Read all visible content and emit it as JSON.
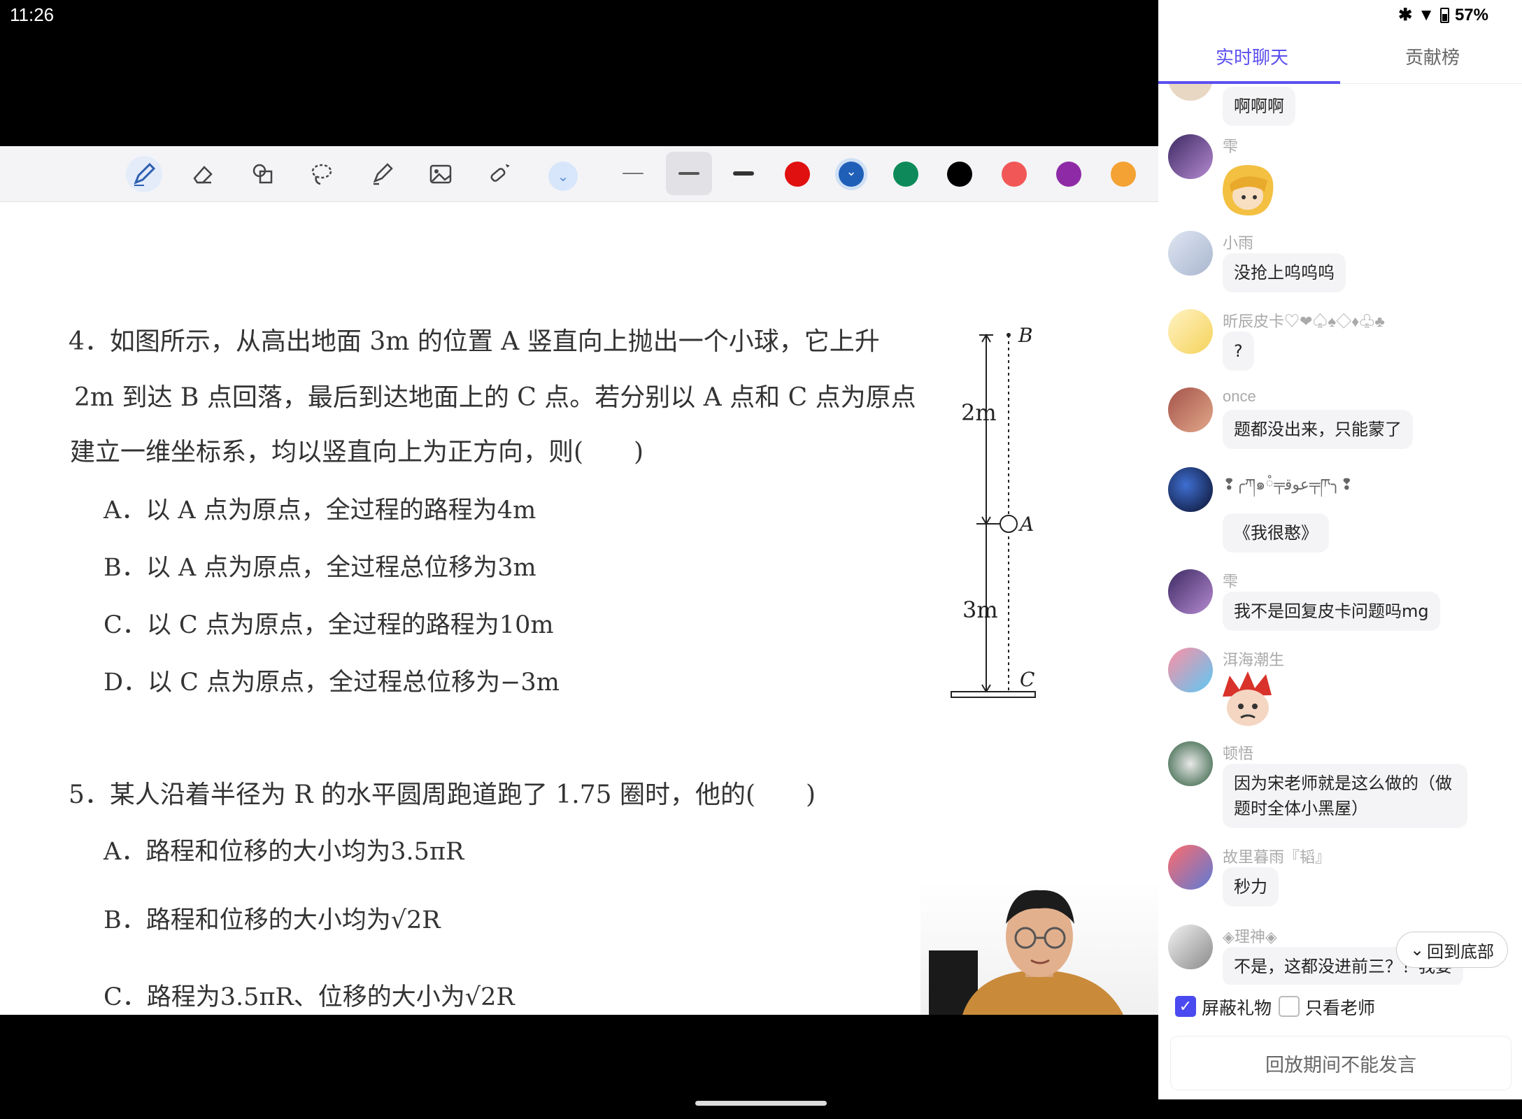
{
  "status": {
    "time": "11:26",
    "battery": "57%"
  },
  "toolbar": {
    "tools": [
      "pen",
      "eraser",
      "shapes",
      "lasso",
      "highlighter",
      "image",
      "laser-pointer"
    ],
    "colors": [
      "#e01010",
      "#1f5fb8",
      "#0e8a5a",
      "#000000",
      "#f25757",
      "#8e2aa6",
      "#f4a233"
    ]
  },
  "question4": {
    "line1": "4．如图所示，从高出地面 3m 的位置 A 竖直向上抛出一个小球，它上升",
    "line2": "2m 到达 B 点回落，最后到达地面上的 C 点。若分别以 A 点和 C 点为原点",
    "line3": "建立一维坐标系，均以竖直向上为正方向，则(　　)",
    "options": [
      "A．以 A 点为原点，全过程的路程为4m",
      "B．以 A 点为原点，全过程总位移为3m",
      "C．以 C 点为原点，全过程的路程为10m",
      "D．以 C 点为原点，全过程总位移为−3m"
    ]
  },
  "diagram": {
    "label_b": "B",
    "label_a": "A",
    "label_c": "C",
    "upper": "2m",
    "lower": "3m"
  },
  "question5": {
    "line1": "5．某人沿着半径为 R 的水平圆周跑道跑了 1.75 圈时，他的(　　)",
    "options": [
      "A．路程和位移的大小均为3.5πR",
      "B．路程和位移的大小均为√2R",
      "C．路程为3.5πR、位移的大小为√2R"
    ]
  },
  "chat": {
    "tabs": [
      "实时聊天",
      "贡献榜"
    ],
    "messages": [
      {
        "user": "",
        "text": "啊啊啊"
      },
      {
        "user": "雫",
        "text": ""
      },
      {
        "user": "小雨",
        "text": "没抢上呜呜呜"
      },
      {
        "user": "昕辰皮卡♡❤♤♠◇♦♧♣",
        "text": "?"
      },
      {
        "user": "once",
        "text": "题都没出来，只能蒙了"
      },
      {
        "user": "❢╭ཀ๑ཾ╤ﻋﻮﻗ╤ཫ╮❢",
        "text": "《我很憨》"
      },
      {
        "user": "雫",
        "text": "我不是回复皮卡问题吗mg"
      },
      {
        "user": "洱海潮生",
        "text": ""
      },
      {
        "user": "顿悟",
        "text": "因为宋老师就是这么做的（做题时全体小黑屋）"
      },
      {
        "user": "故里暮雨『韬』",
        "text": "秒力"
      },
      {
        "user": "◈理神◈",
        "text": "不是，这都没进前三？！我要"
      }
    ],
    "back_to_bottom": "回到底部",
    "filter_gifts": "屏蔽礼物",
    "filter_teacher": "只看老师",
    "input_placeholder": "回放期间不能发言"
  }
}
